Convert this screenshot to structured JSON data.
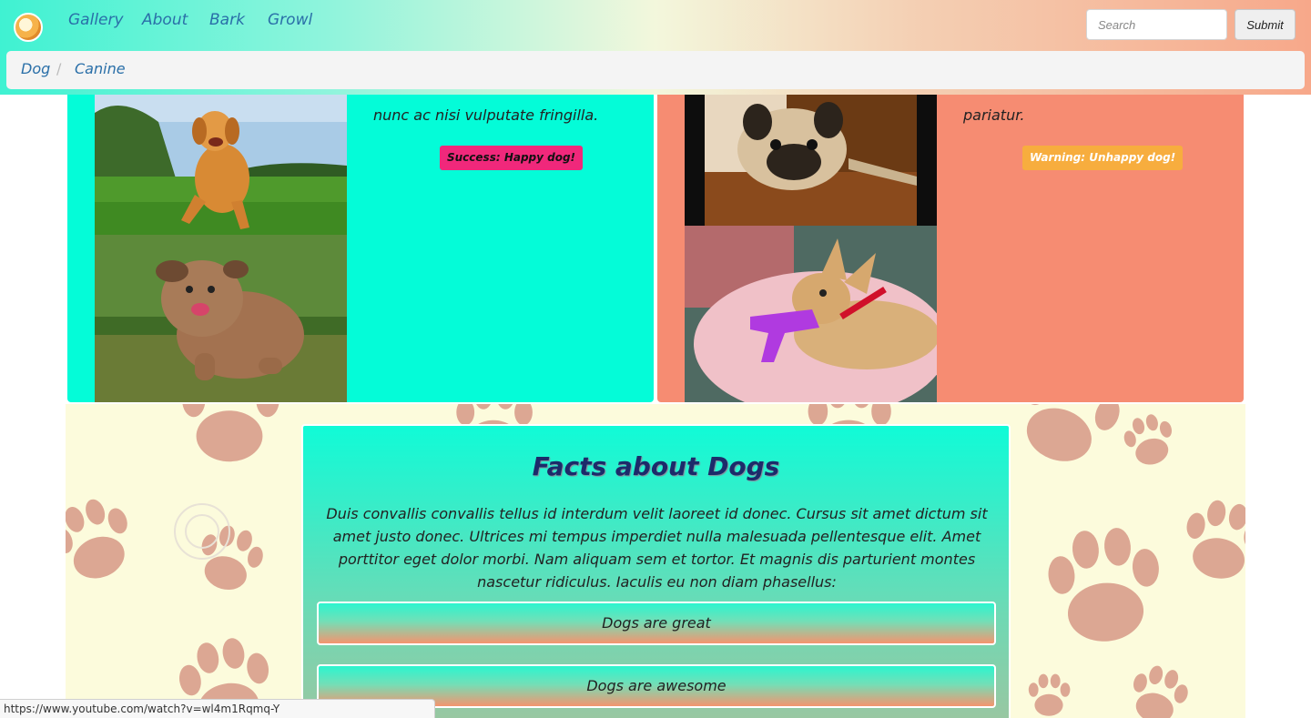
{
  "navbar": {
    "links": [
      "Gallery",
      "About",
      "Bark",
      "Growl"
    ],
    "search_placeholder": "Search",
    "submit_label": "Submit"
  },
  "breadcrumb": [
    "Dog",
    "Canine"
  ],
  "cards": {
    "left": {
      "text": "nunc ac nisi vulputate fringilla.",
      "badge": "Success: Happy dog!"
    },
    "right": {
      "text": "pariatur.",
      "badge": "Warning: Unhappy dog!"
    }
  },
  "facts": {
    "title": "Facts about Dogs",
    "body": "Duis convallis convallis tellus id interdum velit laoreet id donec. Cursus sit amet dictum sit amet justo donec. Ultrices mi tempus imperdiet nulla malesuada pellentesque elit. Amet porttitor eget dolor morbi. Nam aliquam sem et tortor. Et magnis dis parturient montes nascetur ridiculus. Iaculis eu non diam phasellus:",
    "buttons": [
      "Dogs are great",
      "Dogs are awesome"
    ]
  },
  "status_url": "https://www.youtube.com/watch?v=wl4m1Rqmq-Y",
  "colors": {
    "card_left": "#04fcd8",
    "card_right": "#f68c72",
    "badge_success": "#f0287b",
    "badge_warning": "#f7ad3e",
    "paw": "#dca793",
    "link": "#2a6fa8"
  }
}
